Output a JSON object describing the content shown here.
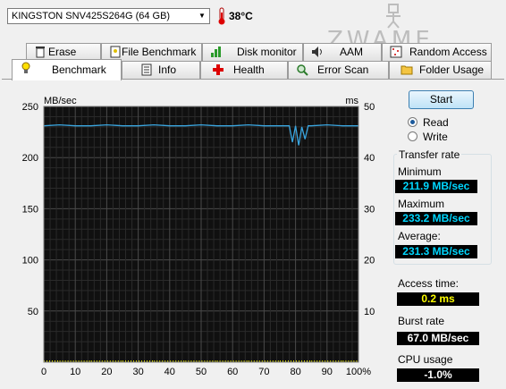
{
  "drive": {
    "name": "KINGSTON SNV425S264G (64 GB)",
    "temperature": "38°C"
  },
  "watermark": "ZWAME",
  "tabs_row1": [
    {
      "label": "Erase",
      "icon": "trash-icon"
    },
    {
      "label": "File Benchmark",
      "icon": "file-benchmark-icon"
    },
    {
      "label": "Disk monitor",
      "icon": "disk-monitor-icon"
    },
    {
      "label": "AAM",
      "icon": "speaker-icon"
    },
    {
      "label": "Random Access",
      "icon": "random-access-icon"
    }
  ],
  "tabs_row2": [
    {
      "label": "Benchmark",
      "icon": "lightbulb-icon",
      "active": true
    },
    {
      "label": "Info",
      "icon": "info-icon"
    },
    {
      "label": "Health",
      "icon": "health-cross-icon"
    },
    {
      "label": "Error Scan",
      "icon": "magnifier-icon"
    },
    {
      "label": "Folder Usage",
      "icon": "folder-icon"
    }
  ],
  "controls": {
    "start_label": "Start",
    "read_label": "Read",
    "write_label": "Write",
    "selected": "Read"
  },
  "stats": {
    "transfer_rate_title": "Transfer rate",
    "minimum_label": "Minimum",
    "minimum_value": "211.9 MB/sec",
    "maximum_label": "Maximum",
    "maximum_value": "233.2 MB/sec",
    "average_label": "Average:",
    "average_value": "231.3 MB/sec",
    "access_label": "Access time:",
    "access_value": "0.2 ms",
    "burst_label": "Burst rate",
    "burst_value": "67.0 MB/sec",
    "cpu_label": "CPU usage",
    "cpu_value": "-1.0%"
  },
  "colors": {
    "plot_bg": "#101010",
    "grid": "#3a3a3a",
    "transfer_line": "#3aa6e0",
    "access_points": "#e8e800"
  },
  "chart_data": {
    "type": "line",
    "left_unit": "MB/sec",
    "right_unit": "ms",
    "ylim_left": [
      0,
      250
    ],
    "ylim_right": [
      0,
      50
    ],
    "xlim": [
      0,
      100
    ],
    "x_ticks": [
      "0",
      "10",
      "20",
      "30",
      "40",
      "50",
      "60",
      "70",
      "80",
      "90",
      "100%"
    ],
    "y_ticks_left": [
      "250",
      "200",
      "150",
      "100",
      "50"
    ],
    "y_ticks_right": [
      "50",
      "40",
      "30",
      "20",
      "10"
    ],
    "grid": true,
    "series": [
      {
        "axis": "left",
        "x": [
          0,
          5,
          10,
          15,
          20,
          25,
          30,
          35,
          40,
          45,
          50,
          55,
          60,
          65,
          70,
          75,
          78,
          79,
          80,
          81,
          82,
          83,
          84,
          85,
          90,
          95,
          100
        ],
        "y": [
          231,
          232,
          231,
          231,
          232,
          231,
          231,
          232,
          231,
          231,
          232,
          231,
          231,
          232,
          231,
          231,
          231,
          215,
          231,
          212,
          230,
          218,
          231,
          231,
          232,
          231,
          231
        ]
      },
      {
        "axis": "right",
        "x": [
          0,
          10,
          20,
          30,
          40,
          50,
          60,
          70,
          80,
          90,
          100
        ],
        "y": [
          0.2,
          0.2,
          0.2,
          0.2,
          0.2,
          0.2,
          0.2,
          0.2,
          0.2,
          0.2,
          0.2
        ]
      }
    ]
  }
}
